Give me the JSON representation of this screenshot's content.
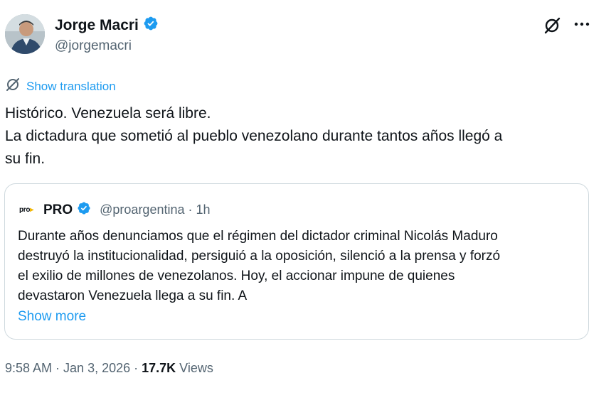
{
  "author": {
    "name": "Jorge Macri",
    "handle": "@jorgemacri"
  },
  "translate": {
    "label": "Show translation"
  },
  "tweet": {
    "lines": [
      "Histórico. Venezuela será libre.",
      "La dictadura que sometió al pueblo venezolano durante tantos años llegó a",
      "su fin."
    ]
  },
  "quote": {
    "logo_text": "pro",
    "name": "PRO",
    "handle_time": "@proargentina · 1h",
    "lines": [
      "Durante años denunciamos que el régimen del dictador criminal Nicolás Maduro",
      "destruyó la institucionalidad, persiguió a la oposición, silenció a la prensa y forzó",
      "el exilio de millones de venezolanos. Hoy, el accionar impune de quienes",
      "devastaron Venezuela llega a su fin. A"
    ],
    "show_more": "Show more"
  },
  "meta": {
    "time": "9:58 AM",
    "sep1": " · ",
    "date": "Jan 3, 2026",
    "sep2": " · ",
    "views_count": "17.7K",
    "views_label": " Views"
  },
  "colors": {
    "accent": "#1d9bf0",
    "verified": "#1d9bf0",
    "muted": "#536471"
  },
  "icons": {
    "verified": "verified-badge-icon",
    "grok": "grok-icon",
    "more": "more-icon",
    "translate": "translate-icon"
  }
}
